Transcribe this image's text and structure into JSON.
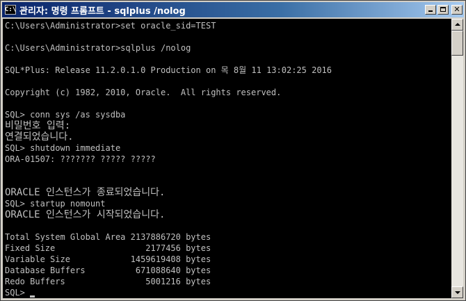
{
  "window": {
    "icon_text": "C:\\",
    "title": "관리자: 명령 프롬프트 - sqlplus  /nolog"
  },
  "console": {
    "lines": [
      "C:\\Users\\Administrator>set oracle_sid=TEST",
      "",
      "C:\\Users\\Administrator>sqlplus /nolog",
      "",
      "SQL*Plus: Release 11.2.0.1.0 Production on 목 8월 11 13:02:25 2016",
      "",
      "Copyright (c) 1982, 2010, Oracle.  All rights reserved.",
      "",
      "SQL> conn sys /as sysdba",
      "비밀번호 입력:",
      "연결되었습니다.",
      "SQL> shutdown immediate",
      "ORA-01507: ??????? ????? ?????",
      "",
      "",
      "ORACLE 인스턴스가 종료되었습니다.",
      "SQL> startup nomount",
      "ORACLE 인스턴스가 시작되었습니다.",
      "",
      "Total System Global Area 2137886720 bytes",
      "Fixed Size                  2177456 bytes",
      "Variable Size            1459619408 bytes",
      "Database Buffers          671088640 bytes",
      "Redo Buffers                5001216 bytes",
      "SQL> "
    ]
  }
}
